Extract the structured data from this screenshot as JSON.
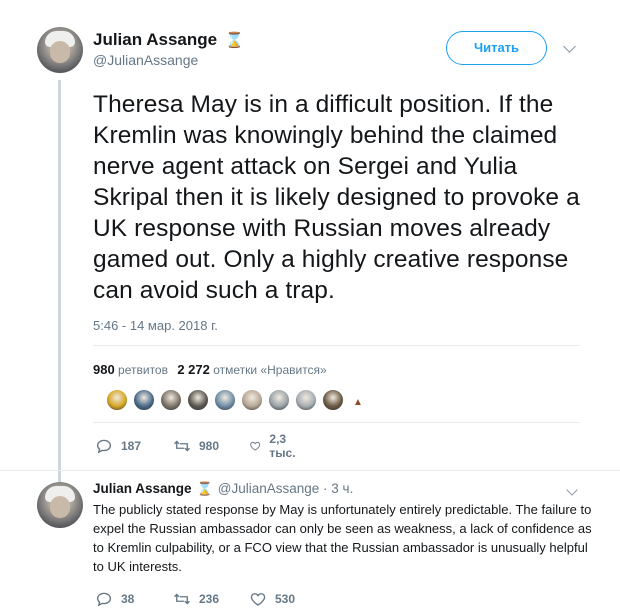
{
  "main_tweet": {
    "author_name": "Julian Assange",
    "badge_glyph": "⌛",
    "handle": "@JulianAssange",
    "follow_label": "Читать",
    "text": "Theresa May is in a difficult position. If the Kremlin was knowingly behind the claimed nerve agent attack on Sergei and Yulia Skripal then it is likely  designed to provoke a UK response with Russian moves already gamed out. Only a highly creative response can avoid such a trap.",
    "timestamp": "5:46 - 14 мар. 2018 г.",
    "stats": {
      "retweets_count": "980",
      "retweets_label": "ретвитов",
      "likes_count": "2 272",
      "likes_label": "отметки «Нравится»"
    },
    "likers": [
      {
        "color": "#d6a624",
        "icon": "avatar"
      },
      {
        "color": "#4a6b8a",
        "icon": "avatar"
      },
      {
        "color": "#7d7468",
        "icon": "avatar"
      },
      {
        "color": "#5a5750",
        "icon": "avatar"
      },
      {
        "color": "#6f8fa8",
        "icon": "avatar"
      },
      {
        "color": "#b8a896",
        "icon": "avatar"
      },
      {
        "color": "#9aa3a8",
        "icon": "avatar"
      },
      {
        "color": "#a7aeb3",
        "icon": "default-avatar"
      },
      {
        "color": "#6b5a44",
        "icon": "avatar"
      }
    ],
    "actions": {
      "replies": "187",
      "retweets": "980",
      "likes": "2,3 тыс."
    }
  },
  "reply_tweet": {
    "author_name": "Julian Assange",
    "badge_glyph": "⌛",
    "handle": "@JulianAssange",
    "separator": "·",
    "time_ago": "3 ч.",
    "text": "The publicly stated response by May is unfortunately entirely predictable. The failure to expel the Russian ambassador can only be seen as weakness, a lack of confidence as to Kremlin culpability, or a FCO view that the Russian ambassador is unusually helpful to UK interests.",
    "actions": {
      "replies": "38",
      "retweets": "236",
      "likes": "530"
    }
  },
  "colors": {
    "accent": "#1da1f2",
    "secondary_text": "#657786",
    "primary_text": "#14171a",
    "thread_line": "#ccd6dd",
    "badge": "#c8a03a"
  }
}
